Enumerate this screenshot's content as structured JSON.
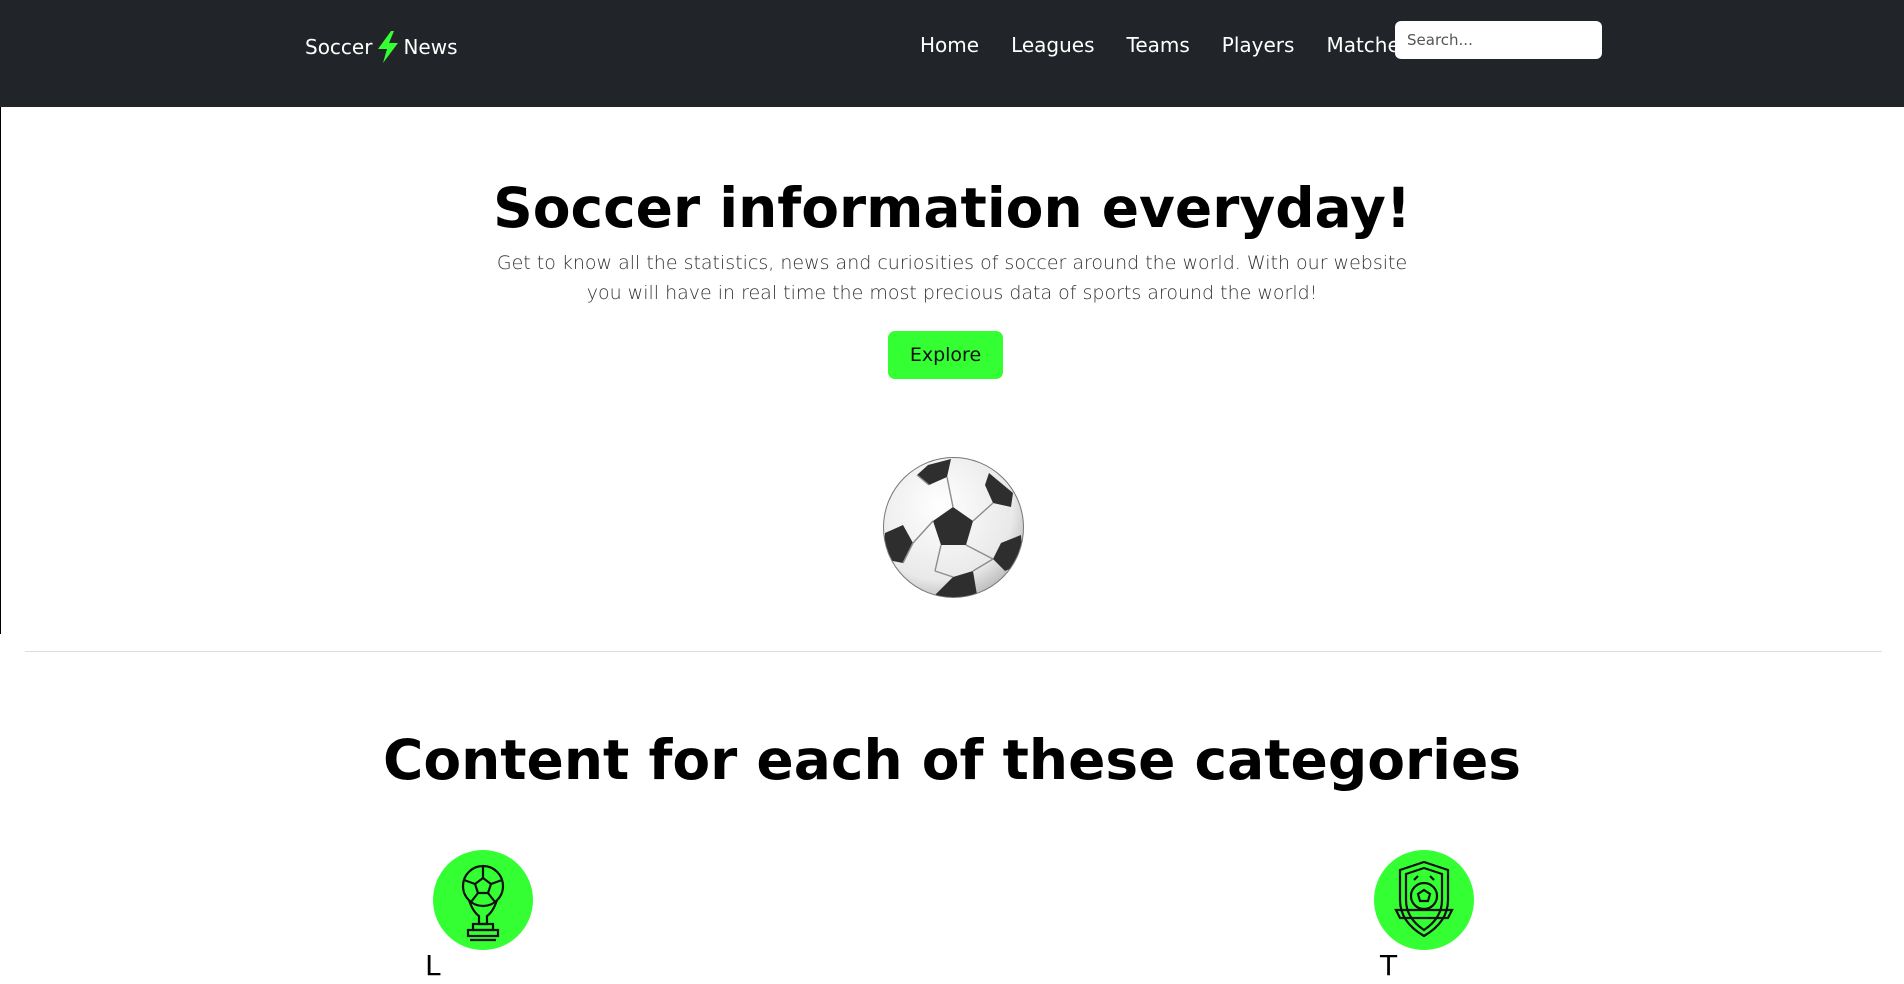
{
  "navbar": {
    "brand": {
      "part1": "Soccer",
      "part2": "News",
      "bolt_icon": "lightning-bolt-icon",
      "bolt_color": "#33ff33"
    },
    "links": [
      "Home",
      "Leagues",
      "Teams",
      "Players",
      "Matches"
    ],
    "search": {
      "placeholder": "Search...",
      "value": ""
    },
    "background": "#212529"
  },
  "hero": {
    "title": "Soccer information everyday!",
    "lead": "Get to know all the statistics, news and curiosities of soccer around the world. With our website you will have in real time the most precious data of sports around the world!",
    "button_label": "Explore",
    "button_color": "#33ff33",
    "image_icon": "soccer-ball-icon"
  },
  "categories": {
    "title": "Content for each of these categories",
    "accent": "#33ff33",
    "items": [
      {
        "label": "L",
        "icon": "trophy-icon"
      },
      {
        "label": "T",
        "icon": "shield-crest-icon"
      }
    ]
  }
}
